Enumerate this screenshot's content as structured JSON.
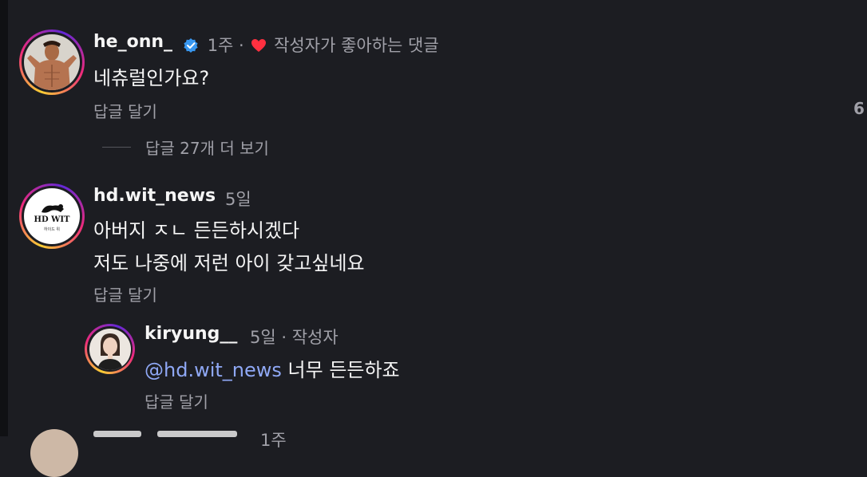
{
  "comments": [
    {
      "username": "he_onn_",
      "time": "1주 ·",
      "liked_by_author_label": "작성자가 좋아하는 댓글",
      "text": "네츄럴인가요?",
      "reply_label": "답글 달기",
      "like_count": "6",
      "view_replies_label": "답글 27개 더 보기"
    },
    {
      "username": "hd.wit_news",
      "time": "5일",
      "avatar_text": "HD WIT",
      "avatar_subtext": "하이드 위",
      "text_line1": "아버지 ㅈㄴ 든든하시겠다",
      "text_line2": "저도 나중에 저런 아이 갖고싶네요",
      "reply_label": "답글 달기"
    }
  ],
  "reply": {
    "username": "kiryung__",
    "time": "5일 · 작성자",
    "mention": "@hd.wit_news",
    "text": "너무 든든하죠",
    "reply_label": "답글 달기"
  },
  "partial_next": {
    "time": "1주"
  },
  "colors": {
    "background": "#1c1d22",
    "text_primary": "#f5f5f5",
    "text_secondary": "#a0a0a8",
    "mention": "#8fa8f5",
    "verified": "#3897f0",
    "heart": "#ff3040"
  }
}
